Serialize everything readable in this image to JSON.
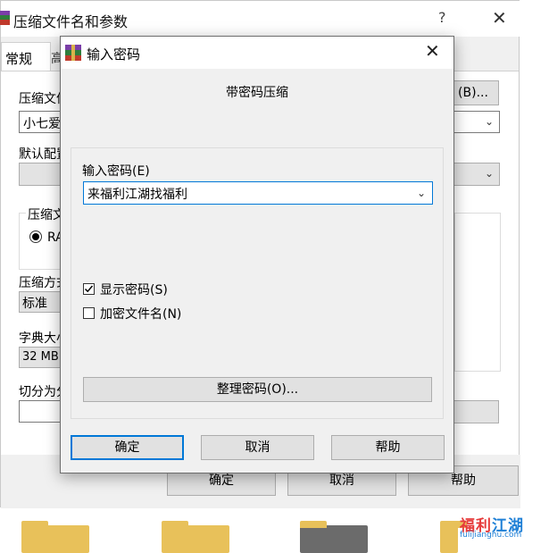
{
  "background_window": {
    "title": "压缩文件名和参数",
    "help_glyph": "?",
    "close_glyph": "✕",
    "tabs": [
      "常规",
      "高"
    ],
    "archive_name_label": "压缩文件",
    "archive_name_value": "小七爱",
    "browse_button": "(B)...",
    "default_profile_label": "默认配置",
    "format_group_label": "压缩文",
    "format_option": "RA",
    "method_label": "压缩方式",
    "method_value": "标准",
    "dict_label": "字典大小",
    "dict_value": "32 MB",
    "split_label": "切分为分",
    "ok_button": "确定",
    "cancel_button": "取消",
    "help_button": "帮助"
  },
  "dialog": {
    "title": "输入密码",
    "close_glyph": "✕",
    "heading": "带密码压缩",
    "password_label": "输入密码(E)",
    "password_value": "来福利江湖找福利",
    "show_password_label": "显示密码(S)",
    "show_password_checked": true,
    "encrypt_names_label": "加密文件名(N)",
    "encrypt_names_checked": false,
    "organize_button": "整理密码(O)...",
    "ok_button": "确定",
    "cancel_button": "取消",
    "help_button": "帮助"
  },
  "watermark": {
    "line1": "福利",
    "line1_b": "江湖",
    "line2": "fulijianghu.com"
  },
  "colors": {
    "accent": "#0078d7",
    "dialog_bg": "#f0f0f0"
  }
}
